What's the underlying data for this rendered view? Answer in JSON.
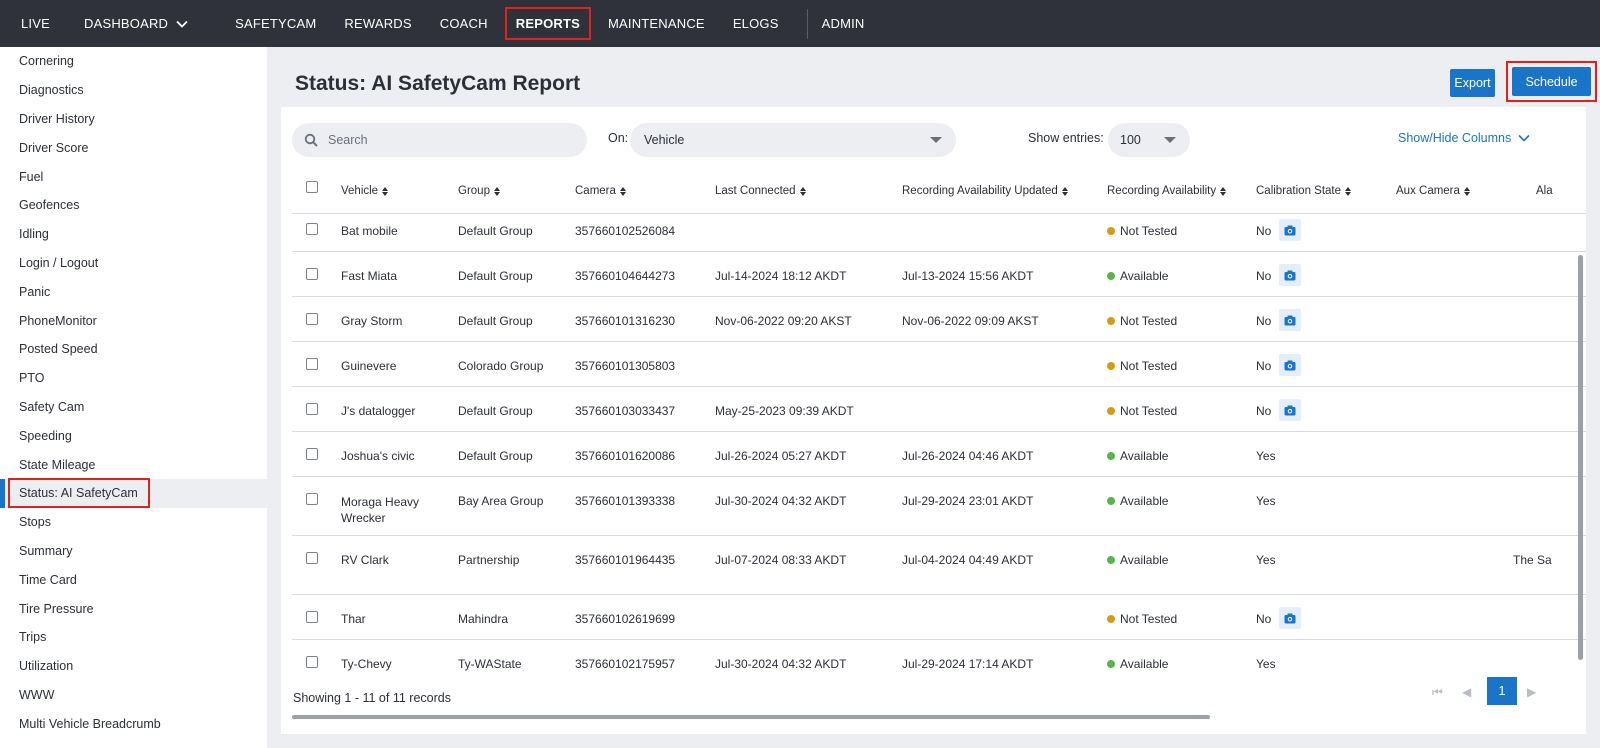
{
  "nav": {
    "items": [
      "LIVE",
      "DASHBOARD",
      "SAFETYCAM",
      "REWARDS",
      "COACH",
      "REPORTS",
      "MAINTENANCE",
      "ELOGS",
      "ADMIN"
    ]
  },
  "sidebar": {
    "items": [
      "Cornering",
      "Diagnostics",
      "Driver History",
      "Driver Score",
      "Fuel",
      "Geofences",
      "Idling",
      "Login / Logout",
      "Panic",
      "PhoneMonitor",
      "Posted Speed",
      "PTO",
      "Safety Cam",
      "Speeding",
      "State Mileage",
      "Status: AI SafetyCam",
      "Stops",
      "Summary",
      "Time Card",
      "Tire Pressure",
      "Trips",
      "Utilization",
      "WWW",
      "Multi Vehicle Breadcrumb"
    ],
    "active_index": 15
  },
  "page": {
    "title": "Status: AI SafetyCam Report",
    "export_label": "Export",
    "schedule_label": "Schedule"
  },
  "filters": {
    "search_placeholder": "Search",
    "on_label": "On:",
    "on_value": "Vehicle",
    "entries_label": "Show entries:",
    "entries_value": "100",
    "show_hide_label": "Show/Hide Columns"
  },
  "table": {
    "columns": [
      "Vehicle",
      "Group",
      "Camera",
      "Last Connected",
      "Recording Availability Updated",
      "Recording Availability",
      "Calibration State",
      "Aux Camera",
      "Ala"
    ],
    "rows": [
      {
        "vehicle": "Bat mobile",
        "group": "Default Group",
        "camera": "357660102526084",
        "last_connected": "",
        "rec_updated": "",
        "availability": "Not Tested",
        "status": "yellow",
        "calibration": "No",
        "camera_icon": true,
        "alarm": ""
      },
      {
        "vehicle": "Fast Miata",
        "group": "Default Group",
        "camera": "357660104644273",
        "last_connected": "Jul-14-2024 18:12 AKDT",
        "rec_updated": "Jul-13-2024 15:56 AKDT",
        "availability": "Available",
        "status": "green",
        "calibration": "No",
        "camera_icon": true,
        "alarm": ""
      },
      {
        "vehicle": "Gray Storm",
        "group": "Default Group",
        "camera": "357660101316230",
        "last_connected": "Nov-06-2022 09:20 AKST",
        "rec_updated": "Nov-06-2022 09:09 AKST",
        "availability": "Not Tested",
        "status": "yellow",
        "calibration": "No",
        "camera_icon": true,
        "alarm": ""
      },
      {
        "vehicle": "Guinevere",
        "group": "Colorado Group",
        "camera": "357660101305803",
        "last_connected": "",
        "rec_updated": "",
        "availability": "Not Tested",
        "status": "yellow",
        "calibration": "No",
        "camera_icon": true,
        "alarm": ""
      },
      {
        "vehicle": "J's datalogger",
        "group": "Default Group",
        "camera": "357660103033437",
        "last_connected": "May-25-2023 09:39 AKDT",
        "rec_updated": "",
        "availability": "Not Tested",
        "status": "yellow",
        "calibration": "No",
        "camera_icon": true,
        "alarm": ""
      },
      {
        "vehicle": "Joshua's civic",
        "group": "Default Group",
        "camera": "357660101620086",
        "last_connected": "Jul-26-2024 05:27 AKDT",
        "rec_updated": "Jul-26-2024 04:46 AKDT",
        "availability": "Available",
        "status": "green",
        "calibration": "Yes",
        "camera_icon": false,
        "alarm": ""
      },
      {
        "vehicle": "Moraga Heavy Wrecker",
        "group": "Bay Area Group",
        "camera": "357660101393338",
        "last_connected": "Jul-30-2024 04:32 AKDT",
        "rec_updated": "Jul-29-2024 23:01 AKDT",
        "availability": "Available",
        "status": "green",
        "calibration": "Yes",
        "camera_icon": false,
        "alarm": ""
      },
      {
        "vehicle": "RV Clark",
        "group": "Partnership",
        "camera": "357660101964435",
        "last_connected": "Jul-07-2024 08:33 AKDT",
        "rec_updated": "Jul-04-2024 04:49 AKDT",
        "availability": "Available",
        "status": "green",
        "calibration": "Yes",
        "camera_icon": false,
        "alarm": "The Sa"
      },
      {
        "vehicle": "Thar",
        "group": "Mahindra",
        "camera": "357660102619699",
        "last_connected": "",
        "rec_updated": "",
        "availability": "Not Tested",
        "status": "yellow",
        "calibration": "No",
        "camera_icon": true,
        "alarm": ""
      },
      {
        "vehicle": "Ty-Chevy",
        "group": "Ty-WAState",
        "camera": "357660102175957",
        "last_connected": "Jul-30-2024 04:32 AKDT",
        "rec_updated": "Jul-29-2024 17:14 AKDT",
        "availability": "Available",
        "status": "green",
        "calibration": "Yes",
        "camera_icon": false,
        "alarm": ""
      }
    ]
  },
  "footer": {
    "showing": "Showing 1 - 11 of 11 records",
    "current_page": "1"
  },
  "colors": {
    "nav_bg": "#2f323b",
    "accent": "#1a74c7",
    "highlight": "#e0221c",
    "not_tested": "#d69b12",
    "available": "#5bb44a"
  }
}
